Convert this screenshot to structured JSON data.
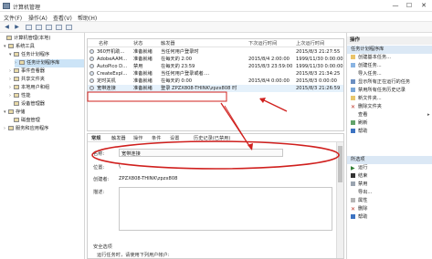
{
  "window": {
    "title": "计算机管理",
    "minimize": "—",
    "maximize": "☐",
    "close": "✕"
  },
  "menu": [
    "文件(F)",
    "操作(A)",
    "查看(V)",
    "帮助(H)"
  ],
  "tree": [
    {
      "label": "计算机管理(本地)",
      "indent": 0,
      "arrow": ""
    },
    {
      "label": "系统工具",
      "indent": 1,
      "arrow": "▾"
    },
    {
      "label": "任务计划程序",
      "indent": 2,
      "arrow": "▾"
    },
    {
      "label": "任务计划程序库",
      "indent": 3,
      "arrow": "›",
      "selected": true
    },
    {
      "label": "事件查看器",
      "indent": 2,
      "arrow": "›"
    },
    {
      "label": "共享文件夹",
      "indent": 2,
      "arrow": "›"
    },
    {
      "label": "本地用户和组",
      "indent": 2,
      "arrow": "›"
    },
    {
      "label": "性能",
      "indent": 2,
      "arrow": "›"
    },
    {
      "label": "设备管理器",
      "indent": 2,
      "arrow": ""
    },
    {
      "label": "存储",
      "indent": 1,
      "arrow": "▾"
    },
    {
      "label": "磁盘管理",
      "indent": 2,
      "arrow": ""
    },
    {
      "label": "服务和应用程序",
      "indent": 1,
      "arrow": "›"
    }
  ],
  "list": {
    "headers": [
      "名称",
      "状态",
      "触发器",
      "下次运行时间",
      "上次运行时间"
    ],
    "rows": [
      {
        "name": "360开机助...",
        "status": "准备就绪",
        "trigger": "当任何用户登录时",
        "next": "",
        "last": "2015/8/3 21:27:55"
      },
      {
        "name": "AdobeAAM...",
        "status": "准备就绪",
        "trigger": "在每天的 2:00",
        "next": "2015/8/4 2:00:00",
        "last": "1999/11/30 0:00:00"
      },
      {
        "name": "AutoPico D...",
        "status": "禁用",
        "trigger": "在每天的 23:59",
        "next": "2015/8/3 23:59:00",
        "last": "1999/11/30 0:00:00"
      },
      {
        "name": "CreateExpl...",
        "status": "准备就绪",
        "trigger": "当任何用户登录或者....",
        "next": "",
        "last": "2015/8/3 21:34:25"
      },
      {
        "name": "定时关机",
        "status": "准备就绪",
        "trigger": "在每天的 0:00",
        "next": "2015/8/4 0:00:00",
        "last": "2015/8/3 0:00:00"
      },
      {
        "name": "宽带连接",
        "status": "准备就绪",
        "trigger": "登录 ZPZX808-THINK\\zpzx808 时",
        "next": "",
        "last": "2015/8/3 21:26:59"
      }
    ]
  },
  "detail": {
    "tabs": [
      "常规",
      "触发器",
      "操作",
      "条件",
      "设置",
      "历史记录(已禁用)"
    ],
    "name_label": "名称:",
    "name_value": "宽带连接",
    "location_label": "位置:",
    "location_value": "\\",
    "author_label": "创建者:",
    "author_value": "ZPZX808-THINK\\zpzx808",
    "desc_label": "描述:",
    "security_label": "安全选项",
    "run_as_label": "运行任务时，请使用下列用户帐户:"
  },
  "actions": {
    "header": "操作",
    "section1": "任务计划程序库",
    "items1": [
      "创建基本任务...",
      "创建任务...",
      "导入任务...",
      "显示所有正在运行的任务",
      "禁用所有任务历史记录",
      "新文件夹...",
      "删除文件夹",
      "查看",
      "刷新",
      "帮助"
    ],
    "section2": "所选项",
    "items2": [
      "运行",
      "结束",
      "禁用",
      "导出...",
      "属性",
      "删除",
      "帮助"
    ]
  },
  "colors": {
    "annotation": "#d0201e",
    "selection": "#cce4f7",
    "accent": "#3a6ea5"
  }
}
